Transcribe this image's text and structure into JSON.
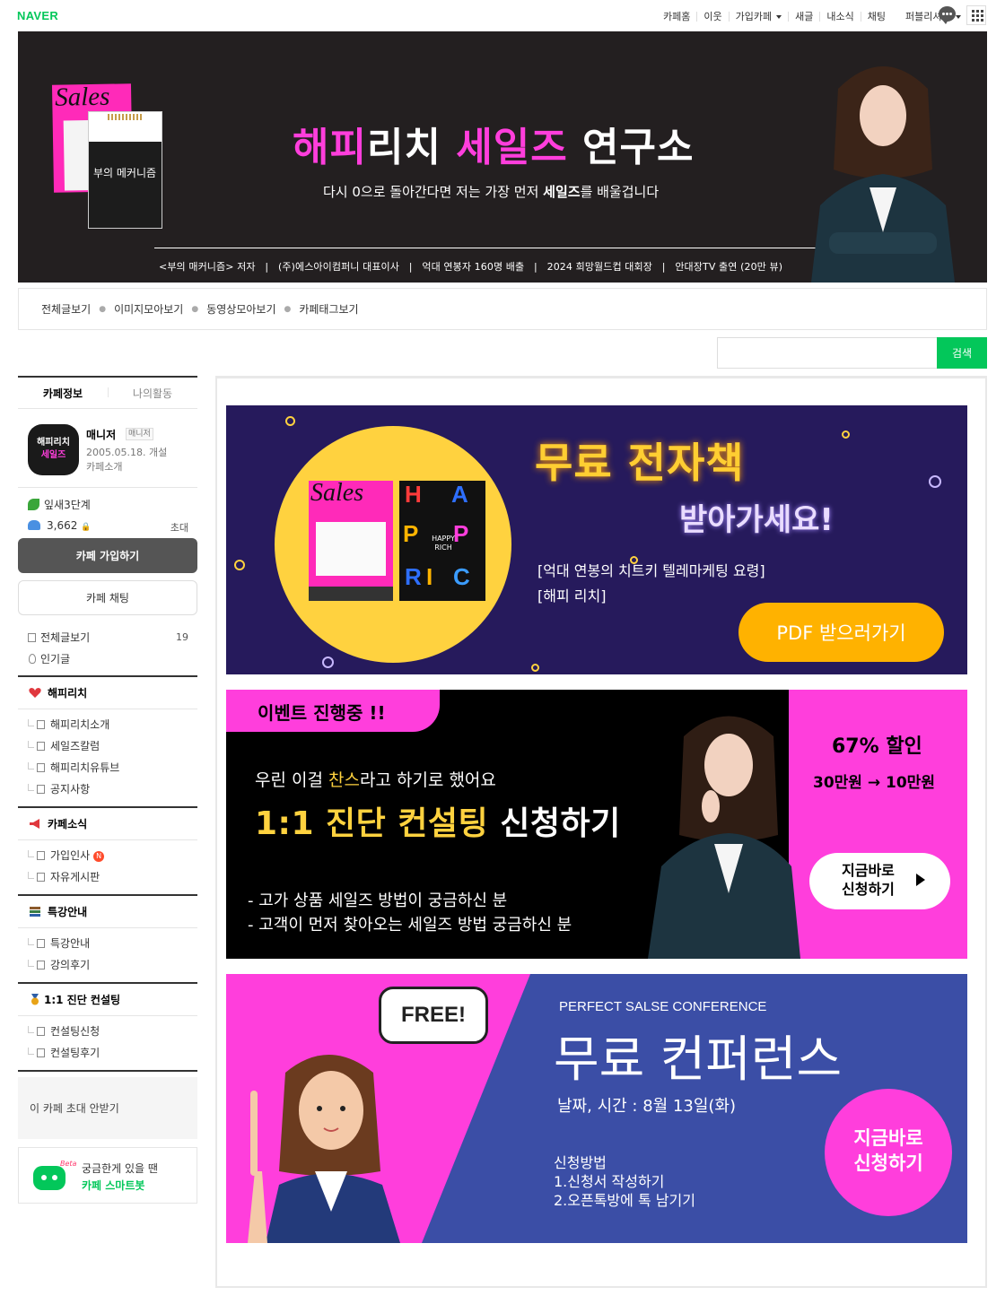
{
  "topbar": {
    "logo": "NAVER",
    "gnb": [
      "카페홈",
      "이웃",
      "가입카페",
      "새글",
      "내소식",
      "채팅"
    ],
    "user": "퍼블리셔 .."
  },
  "banner": {
    "title_a": "해피",
    "title_b": "리치 ",
    "title_c": "세일즈",
    "title_d": " 연구소",
    "subtitle_a": "다시 0으로 돌아간다면 저는 가장 먼저 ",
    "subtitle_b": "세일즈",
    "subtitle_c": "를 배울겁니다",
    "footer": "<부의 매커니즘> 저자   |   (주)에스아이컴퍼니 대표이사   |   억대 연봉자 160명 배출   |   2024 희망월드컵 대회장   |   안대장TV 출연 (20만 뷰)",
    "book1_title": "Sales",
    "book2_title": "부의 메커니즘"
  },
  "subnav": [
    "전체글보기",
    "이미지모아보기",
    "동영상모아보기",
    "카페태그보기"
  ],
  "search": {
    "button": "검색",
    "placeholder": ""
  },
  "sidebar": {
    "tab_info": "카페정보",
    "tab_activity": "나의활동",
    "logo_line1": "해피리치",
    "logo_line2": "세일즈",
    "manager": "매니저",
    "manager_badge": "매니저",
    "date": "2005.05.18. 개설",
    "intro": "카페소개",
    "level": "잎새3단계",
    "members": "3,662",
    "invite": "초대",
    "join": "카페 가입하기",
    "chat": "카페 채팅",
    "all_posts": "전체글보기",
    "all_posts_count": "19",
    "popular": "인기글",
    "categories": [
      {
        "title": "해피리치",
        "items": [
          "해피리치소개",
          "세일즈칼럼",
          "해피리치유튜브",
          "공지사항"
        ]
      },
      {
        "title": "카페소식",
        "items": [
          "가입인사",
          "자유게시판"
        ]
      },
      {
        "title": "특강안내",
        "items": [
          "특강안내",
          "강의후기"
        ]
      },
      {
        "title": "1:1 진단 컨설팅",
        "items": [
          "컨설팅신청",
          "컨설팅후기"
        ]
      }
    ],
    "new_badge": "N",
    "no_invite": "이 카페 초대 안받기",
    "bot_beta": "Beta",
    "bot_line1": "궁금한게 있을 땐",
    "bot_line2": "카페 스마트봇"
  },
  "ad1": {
    "headline": "무료 전자책",
    "sub": "받아가세요!",
    "line1": "[억대 연봉의 치트키 텔레마케팅 요령]",
    "line2": "[해피 리치]",
    "button": "PDF 받으러가기",
    "book_sales": "Sales",
    "book_happy": "HAPPY RICH"
  },
  "ad2": {
    "tag": "이벤트 진행중 !!",
    "line1_a": "우린 이걸 ",
    "line1_b": "찬스",
    "line1_c": "라고 하기로 했어요",
    "line2_a": "1:1 진단 컨설팅",
    "line2_b": " 신청하기",
    "bullet1": "- 고가 상품 세일즈 방법이 궁금하신 분",
    "bullet2": "- 고객이 먼저 찾아오는 세일즈 방법 궁금하신 분",
    "discount": "67% 할인",
    "price": "30만원 → 10만원",
    "btn1": "지금바로",
    "btn2": "신청하기"
  },
  "ad3": {
    "bubble": "FREE!",
    "eng": "PERFECT SALSE CONFERENCE",
    "title": "무료 컨퍼런스",
    "date": "날짜, 시간 : 8월 13일(화)",
    "how": "신청방법",
    "how1": "1.신청서 작성하기",
    "how2": "2.오픈톡방에 톡 남기기",
    "btn1": "지금바로",
    "btn2": "신청하기"
  }
}
